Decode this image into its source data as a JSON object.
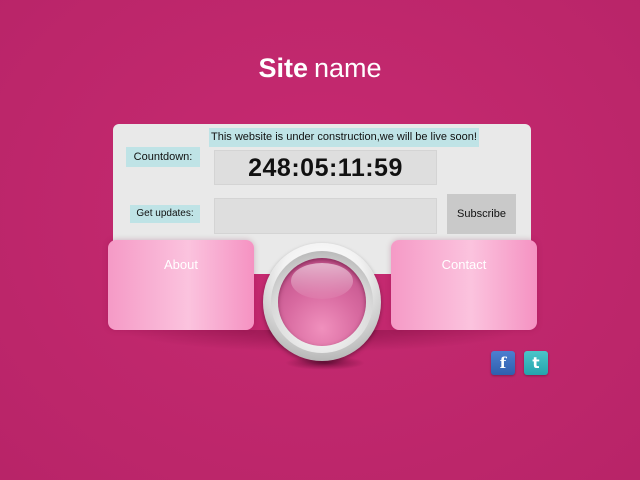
{
  "header": {
    "title_bold": "Site",
    "title_light": "name"
  },
  "panel": {
    "notice": "This website is under construction,we will be live soon!",
    "countdown_label": "Countdown:",
    "countdown_value": "248:05:11:59",
    "updates_label": "Get updates:",
    "email_value": "",
    "subscribe_label": "Subscribe"
  },
  "cards": {
    "about_label": "About",
    "contact_label": "Contact"
  },
  "social": {
    "facebook_glyph": "f",
    "twitter_glyph": "t",
    "facebook_color": "#3a6bbf",
    "twitter_color": "#2fb3bb"
  },
  "colors": {
    "background": "#c0286e",
    "panel": "#e9e9e9",
    "label_bg": "#bfe3e6",
    "card_pink": "#f9aed2"
  }
}
